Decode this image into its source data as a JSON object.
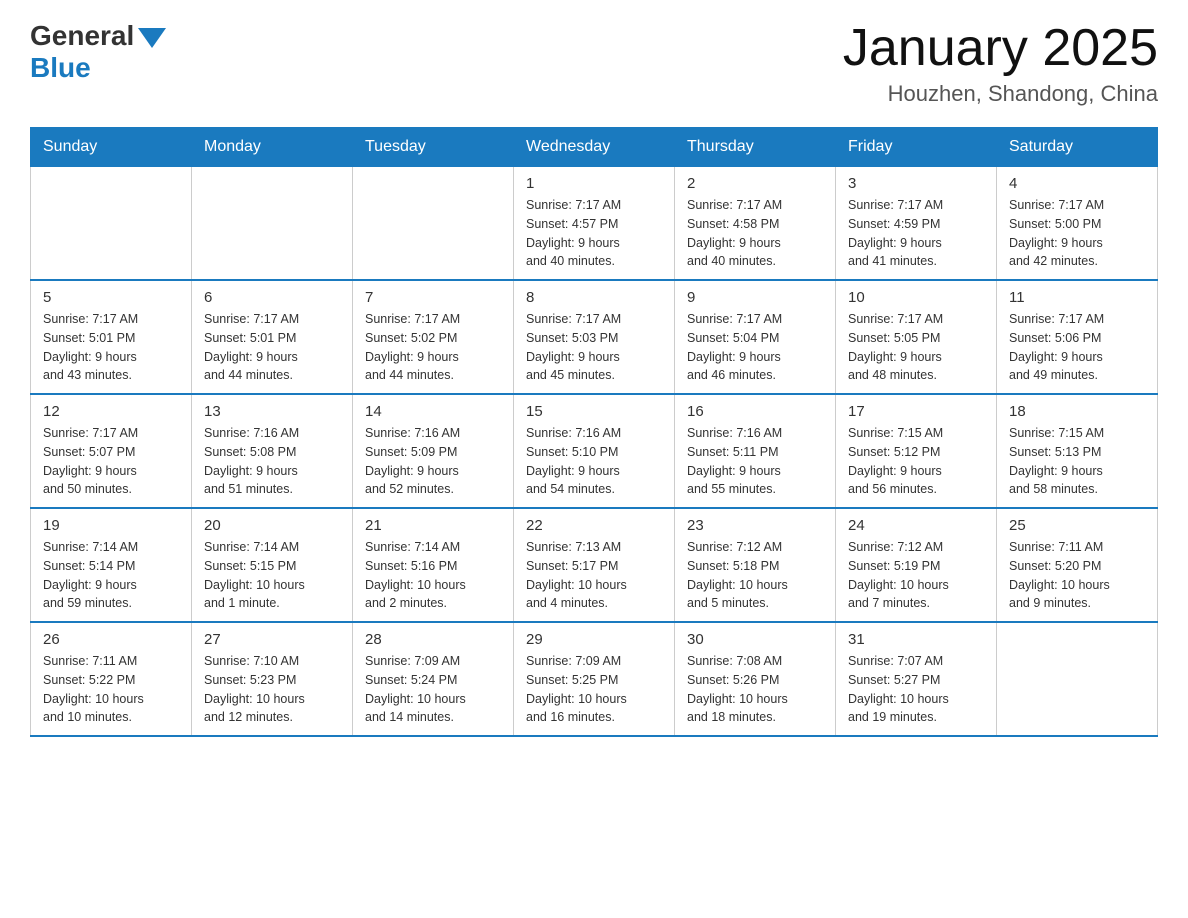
{
  "header": {
    "logo_general": "General",
    "logo_blue": "Blue",
    "title": "January 2025",
    "subtitle": "Houzhen, Shandong, China"
  },
  "weekdays": [
    "Sunday",
    "Monday",
    "Tuesday",
    "Wednesday",
    "Thursday",
    "Friday",
    "Saturday"
  ],
  "weeks": [
    [
      {
        "day": "",
        "info": ""
      },
      {
        "day": "",
        "info": ""
      },
      {
        "day": "",
        "info": ""
      },
      {
        "day": "1",
        "info": "Sunrise: 7:17 AM\nSunset: 4:57 PM\nDaylight: 9 hours\nand 40 minutes."
      },
      {
        "day": "2",
        "info": "Sunrise: 7:17 AM\nSunset: 4:58 PM\nDaylight: 9 hours\nand 40 minutes."
      },
      {
        "day": "3",
        "info": "Sunrise: 7:17 AM\nSunset: 4:59 PM\nDaylight: 9 hours\nand 41 minutes."
      },
      {
        "day": "4",
        "info": "Sunrise: 7:17 AM\nSunset: 5:00 PM\nDaylight: 9 hours\nand 42 minutes."
      }
    ],
    [
      {
        "day": "5",
        "info": "Sunrise: 7:17 AM\nSunset: 5:01 PM\nDaylight: 9 hours\nand 43 minutes."
      },
      {
        "day": "6",
        "info": "Sunrise: 7:17 AM\nSunset: 5:01 PM\nDaylight: 9 hours\nand 44 minutes."
      },
      {
        "day": "7",
        "info": "Sunrise: 7:17 AM\nSunset: 5:02 PM\nDaylight: 9 hours\nand 44 minutes."
      },
      {
        "day": "8",
        "info": "Sunrise: 7:17 AM\nSunset: 5:03 PM\nDaylight: 9 hours\nand 45 minutes."
      },
      {
        "day": "9",
        "info": "Sunrise: 7:17 AM\nSunset: 5:04 PM\nDaylight: 9 hours\nand 46 minutes."
      },
      {
        "day": "10",
        "info": "Sunrise: 7:17 AM\nSunset: 5:05 PM\nDaylight: 9 hours\nand 48 minutes."
      },
      {
        "day": "11",
        "info": "Sunrise: 7:17 AM\nSunset: 5:06 PM\nDaylight: 9 hours\nand 49 minutes."
      }
    ],
    [
      {
        "day": "12",
        "info": "Sunrise: 7:17 AM\nSunset: 5:07 PM\nDaylight: 9 hours\nand 50 minutes."
      },
      {
        "day": "13",
        "info": "Sunrise: 7:16 AM\nSunset: 5:08 PM\nDaylight: 9 hours\nand 51 minutes."
      },
      {
        "day": "14",
        "info": "Sunrise: 7:16 AM\nSunset: 5:09 PM\nDaylight: 9 hours\nand 52 minutes."
      },
      {
        "day": "15",
        "info": "Sunrise: 7:16 AM\nSunset: 5:10 PM\nDaylight: 9 hours\nand 54 minutes."
      },
      {
        "day": "16",
        "info": "Sunrise: 7:16 AM\nSunset: 5:11 PM\nDaylight: 9 hours\nand 55 minutes."
      },
      {
        "day": "17",
        "info": "Sunrise: 7:15 AM\nSunset: 5:12 PM\nDaylight: 9 hours\nand 56 minutes."
      },
      {
        "day": "18",
        "info": "Sunrise: 7:15 AM\nSunset: 5:13 PM\nDaylight: 9 hours\nand 58 minutes."
      }
    ],
    [
      {
        "day": "19",
        "info": "Sunrise: 7:14 AM\nSunset: 5:14 PM\nDaylight: 9 hours\nand 59 minutes."
      },
      {
        "day": "20",
        "info": "Sunrise: 7:14 AM\nSunset: 5:15 PM\nDaylight: 10 hours\nand 1 minute."
      },
      {
        "day": "21",
        "info": "Sunrise: 7:14 AM\nSunset: 5:16 PM\nDaylight: 10 hours\nand 2 minutes."
      },
      {
        "day": "22",
        "info": "Sunrise: 7:13 AM\nSunset: 5:17 PM\nDaylight: 10 hours\nand 4 minutes."
      },
      {
        "day": "23",
        "info": "Sunrise: 7:12 AM\nSunset: 5:18 PM\nDaylight: 10 hours\nand 5 minutes."
      },
      {
        "day": "24",
        "info": "Sunrise: 7:12 AM\nSunset: 5:19 PM\nDaylight: 10 hours\nand 7 minutes."
      },
      {
        "day": "25",
        "info": "Sunrise: 7:11 AM\nSunset: 5:20 PM\nDaylight: 10 hours\nand 9 minutes."
      }
    ],
    [
      {
        "day": "26",
        "info": "Sunrise: 7:11 AM\nSunset: 5:22 PM\nDaylight: 10 hours\nand 10 minutes."
      },
      {
        "day": "27",
        "info": "Sunrise: 7:10 AM\nSunset: 5:23 PM\nDaylight: 10 hours\nand 12 minutes."
      },
      {
        "day": "28",
        "info": "Sunrise: 7:09 AM\nSunset: 5:24 PM\nDaylight: 10 hours\nand 14 minutes."
      },
      {
        "day": "29",
        "info": "Sunrise: 7:09 AM\nSunset: 5:25 PM\nDaylight: 10 hours\nand 16 minutes."
      },
      {
        "day": "30",
        "info": "Sunrise: 7:08 AM\nSunset: 5:26 PM\nDaylight: 10 hours\nand 18 minutes."
      },
      {
        "day": "31",
        "info": "Sunrise: 7:07 AM\nSunset: 5:27 PM\nDaylight: 10 hours\nand 19 minutes."
      },
      {
        "day": "",
        "info": ""
      }
    ]
  ]
}
